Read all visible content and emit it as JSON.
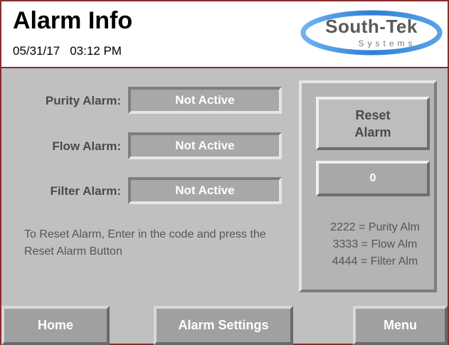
{
  "header": {
    "title": "Alarm Info",
    "date": "05/31/17",
    "time": "03:12 PM",
    "logo_text": "South-Tek",
    "logo_subtext": "Systems"
  },
  "alarms": [
    {
      "label": "Purity Alarm:",
      "status": "Not Active"
    },
    {
      "label": "Flow Alarm:",
      "status": "Not Active"
    },
    {
      "label": "Filter Alarm:",
      "status": "Not Active"
    }
  ],
  "instructions": "To Reset Alarm, Enter in the code and press the Reset Alarm Button",
  "reset": {
    "button_line1": "Reset",
    "button_line2": "Alarm",
    "code_value": "0"
  },
  "codes": [
    "2222 = Purity Alm",
    "3333 = Flow Alm",
    "4444 = Filter Alm"
  ],
  "nav": {
    "home": "Home",
    "alarm_settings": "Alarm Settings",
    "menu": "Menu"
  },
  "colors": {
    "frame_border": "#8a2c2c",
    "background": "#c0c0c0",
    "logo_swoosh": "#2e7fd6"
  }
}
